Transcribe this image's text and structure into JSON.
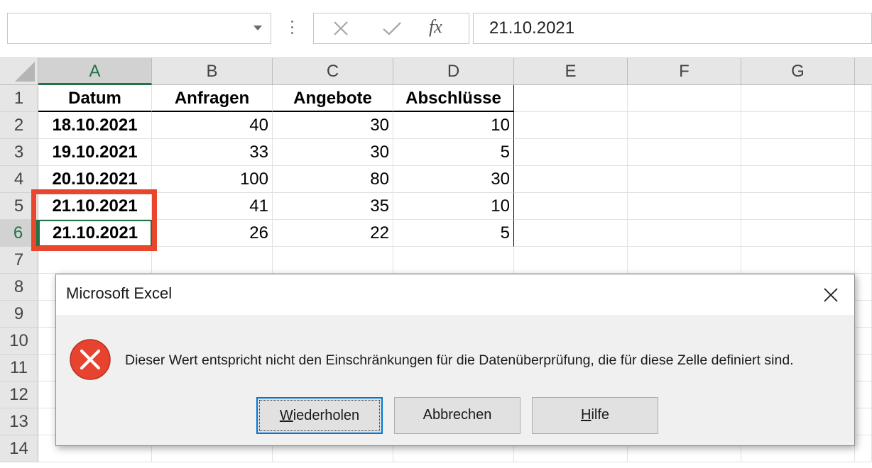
{
  "formula_bar": {
    "name_box": "",
    "cancel_icon": "cross-icon",
    "enter_icon": "check-icon",
    "fx_label": "fx",
    "formula_value": "21.10.2021"
  },
  "sheet": {
    "columns": [
      "A",
      "B",
      "C",
      "D",
      "E",
      "F",
      "G"
    ],
    "rows": [
      "1",
      "2",
      "3",
      "4",
      "5",
      "6",
      "7",
      "8",
      "9",
      "10",
      "11",
      "12",
      "13",
      "14"
    ],
    "selected_column": "A",
    "selected_row": "6",
    "headers": [
      "Datum",
      "Anfragen",
      "Angebote",
      "Abschlüsse"
    ],
    "data": [
      [
        "18.10.2021",
        "40",
        "30",
        "10"
      ],
      [
        "19.10.2021",
        "33",
        "30",
        "5"
      ],
      [
        "20.10.2021",
        "100",
        "80",
        "30"
      ],
      [
        "21.10.2021",
        "41",
        "35",
        "10"
      ],
      [
        "21.10.2021",
        "26",
        "22",
        "5"
      ]
    ],
    "highlight_color": "#e8472e",
    "accent_color": "#217346"
  },
  "dialog": {
    "title": "Microsoft Excel",
    "close_icon": "close-icon",
    "error_icon": "error-x-icon",
    "message": "Dieser Wert entspricht nicht den Einschränkungen für die Datenüberprüfung, die für diese Zelle definiert sind.",
    "buttons": {
      "retry_access": "W",
      "retry_rest": "iederholen",
      "cancel": "Abbrechen",
      "help_access": "H",
      "help_rest": "ilfe"
    }
  }
}
